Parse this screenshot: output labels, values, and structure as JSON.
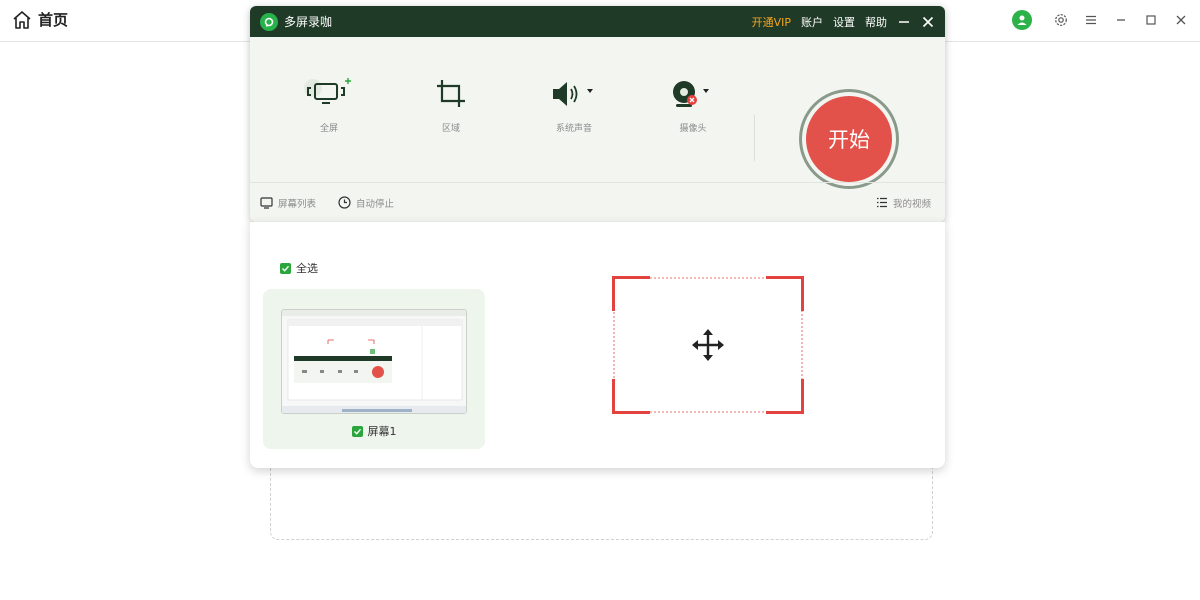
{
  "host": {
    "title": "首页",
    "icons": {
      "home": "home-icon",
      "avatar": "user-avatar-icon",
      "settings": "gear-icon",
      "menu": "menu-icon",
      "minimize": "minimize-icon",
      "maximize": "maximize-icon",
      "close": "close-icon"
    }
  },
  "recorder": {
    "app_name": "多屏录咖",
    "menu": {
      "vip": "开通VIP",
      "account": "账户",
      "settings": "设置",
      "help": "帮助"
    },
    "tools": [
      {
        "label": "全屏",
        "icon": "fullscreen-icon"
      },
      {
        "label": "区域",
        "icon": "crop-icon"
      },
      {
        "label": "系统声音",
        "icon": "speaker-icon"
      },
      {
        "label": "摄像头",
        "icon": "camera-icon"
      }
    ],
    "start_label": "开始",
    "bottom": {
      "screen_list": "屏幕列表",
      "auto_stop": "自动停止",
      "my_videos": "我的视频"
    }
  },
  "panel": {
    "select_all": "全选",
    "screens": [
      {
        "label": "屏幕1",
        "checked": true
      }
    ]
  },
  "colors": {
    "title_bar": "#1f3a26",
    "accent_green": "#2aa63c",
    "start_red": "#e2514a",
    "vip_orange": "#f5a623",
    "region_red": "#e2433f"
  }
}
